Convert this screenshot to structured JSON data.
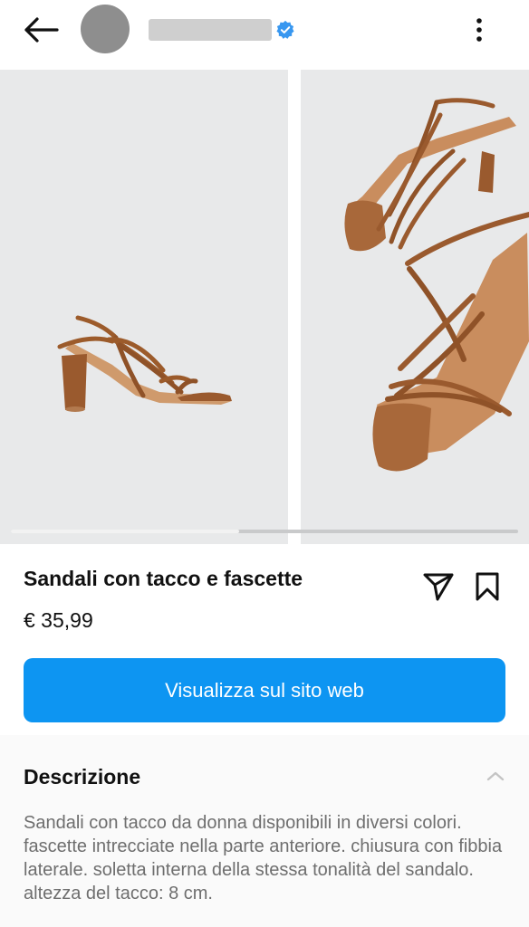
{
  "header": {
    "back_icon": "arrow-left-icon",
    "verified_icon": "verified-badge-icon",
    "verified_color": "#3897f0",
    "more_icon": "more-vertical-icon"
  },
  "gallery": {
    "slides": [
      {
        "alt": "side-view-sandal-image"
      },
      {
        "alt": "top-view-sandals-image"
      }
    ],
    "progress_fraction": 0.45
  },
  "product": {
    "title": "Sandali con tacco e fascette",
    "price": "€ 35,99",
    "share_icon": "send-icon",
    "save_icon": "bookmark-icon"
  },
  "cta": {
    "label": "Visualizza sul sito web",
    "color": "#0d95f2"
  },
  "description": {
    "title": "Descrizione",
    "toggle_icon": "chevron-up-icon",
    "text": "Sandali con tacco da donna disponibili in diversi colori. fascette intrecciate nella parte anteriore. chiusura con fibbia laterale. soletta interna della stessa tonalità del sandalo. altezza del tacco: 8 cm."
  }
}
